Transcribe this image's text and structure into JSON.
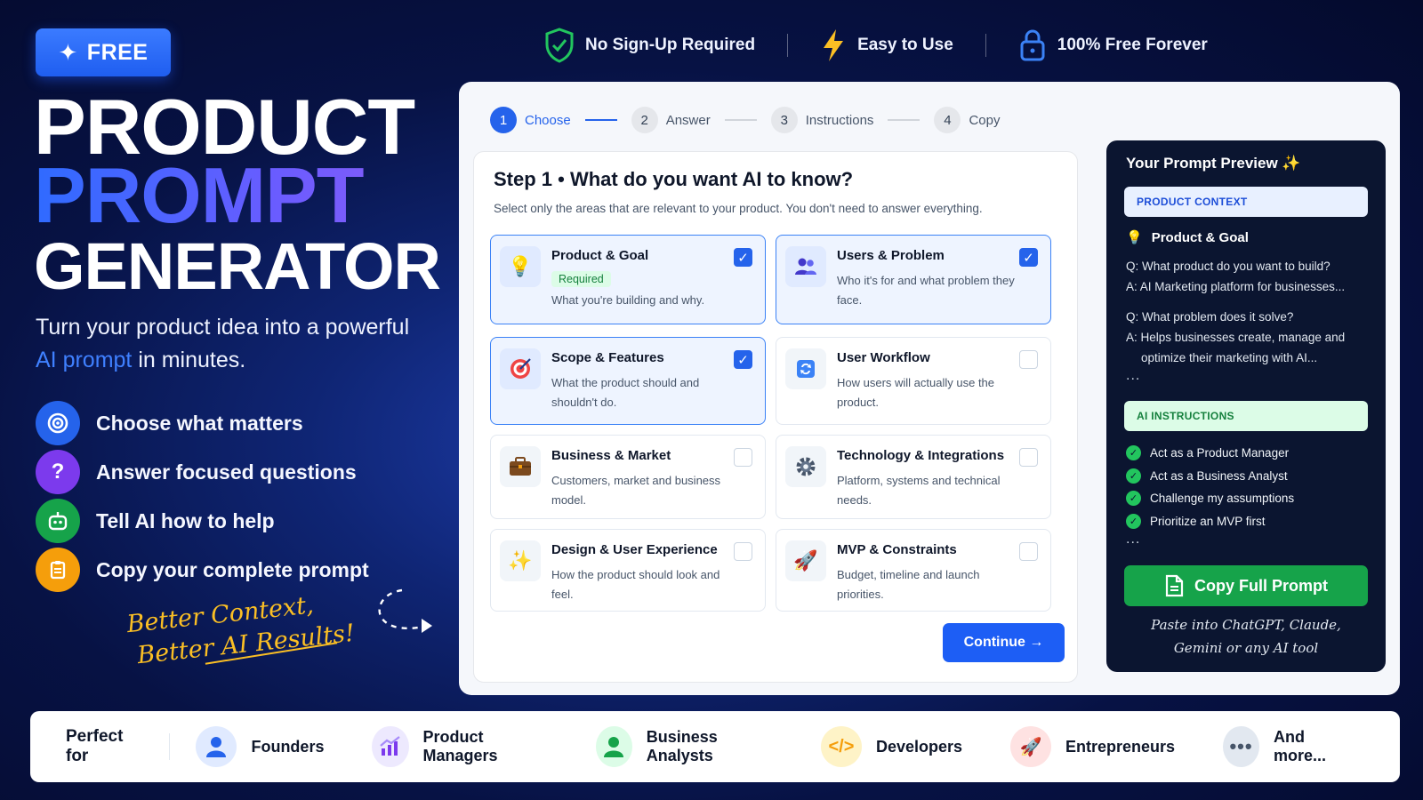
{
  "badge": {
    "label": "FREE"
  },
  "hero": {
    "line1": "PRODUCT",
    "line2": "PROMPT",
    "line3": "GENERATOR",
    "sub_a": "Turn your product idea into a powerful",
    "sub_highlight": "AI prompt",
    "sub_b": " in minutes."
  },
  "features": [
    {
      "icon": "target-icon",
      "label": "Choose what matters"
    },
    {
      "icon": "question-icon",
      "label": "Answer focused questions"
    },
    {
      "icon": "robot-icon",
      "label": "Tell AI how to help"
    },
    {
      "icon": "clipboard-icon",
      "label": "Copy your complete prompt"
    }
  ],
  "tagline": {
    "line1": "Better Context,",
    "line2": "Better AI Results!"
  },
  "top_pills": [
    {
      "icon": "shield-check-icon",
      "label": "No Sign-Up Required"
    },
    {
      "icon": "lightning-icon",
      "label": "Easy to Use"
    },
    {
      "icon": "lock-icon",
      "label": "100% Free Forever"
    }
  ],
  "stepper": [
    {
      "num": "1",
      "label": "Choose",
      "active": true
    },
    {
      "num": "2",
      "label": "Answer",
      "active": false
    },
    {
      "num": "3",
      "label": "Instructions",
      "active": false
    },
    {
      "num": "4",
      "label": "Copy",
      "active": false
    }
  ],
  "step1": {
    "title": "Step 1 • What do you want AI to know?",
    "desc": "Select only the areas that are relevant to your product. You don't need to answer everything.",
    "options": [
      {
        "icon": "lightbulb-icon",
        "title": "Product & Goal",
        "badge": "Required",
        "desc": "What you're building and why.",
        "checked": true
      },
      {
        "icon": "users-icon",
        "title": "Users & Problem",
        "desc": "Who it's for and what problem they face.",
        "checked": true
      },
      {
        "icon": "target-icon",
        "title": "Scope & Features",
        "desc": "What the product should and shouldn't do.",
        "checked": true
      },
      {
        "icon": "workflow-icon",
        "title": "User Workflow",
        "desc": "How users will actually use the product.",
        "checked": false
      },
      {
        "icon": "briefcase-icon",
        "title": "Business & Market",
        "desc": "Customers, market and business model.",
        "checked": false
      },
      {
        "icon": "gear-icon",
        "title": "Technology & Integrations",
        "desc": "Platform, systems and technical needs.",
        "checked": false
      },
      {
        "icon": "sparkle-icon",
        "title": "Design & User Experience",
        "desc": "How the product should look and feel.",
        "checked": false
      },
      {
        "icon": "rocket-icon",
        "title": "MVP & Constraints",
        "desc": "Budget, timeline and launch priorities.",
        "checked": false
      }
    ],
    "continue_label": "Continue →"
  },
  "preview": {
    "title": "Your Prompt Preview ✨",
    "context_label": "PRODUCT CONTEXT",
    "section": "Product & Goal",
    "q1": "Q: What product do you want to build?",
    "a1": "A: AI Marketing platform for businesses...",
    "q2": "Q: What problem does it solve?",
    "a2a": "A: Helps businesses create, manage and",
    "a2b": "optimize their marketing with AI...",
    "ellipsis": "...",
    "instructions_label": "AI INSTRUCTIONS",
    "instructions": [
      "Act as a Product Manager",
      "Act as a Business Analyst",
      "Challenge my assumptions",
      "Prioritize an MVP first"
    ],
    "copy_label": "Copy Full Prompt",
    "paste_line1": "Paste into ChatGPT, Claude,",
    "paste_line2": "Gemini or any AI tool"
  },
  "bottom": {
    "label": "Perfect for",
    "items": [
      {
        "icon": "person-icon",
        "label": "Founders",
        "color": "#2563eb",
        "bg": "#e0eaff"
      },
      {
        "icon": "chart-icon",
        "label": "Product Managers",
        "color": "#7c3aed",
        "bg": "#ede9fe"
      },
      {
        "icon": "person-icon",
        "label": "Business Analysts",
        "color": "#16a34a",
        "bg": "#dcfce7"
      },
      {
        "icon": "code-icon",
        "label": "Developers",
        "color": "#f59e0b",
        "bg": "#fef3c7"
      },
      {
        "icon": "rocket-icon",
        "label": "Entrepreneurs",
        "color": "#ef4444",
        "bg": "#fee2e2"
      },
      {
        "icon": "more-icon",
        "label": "And more...",
        "color": "#475569",
        "bg": "#e2e8f0"
      }
    ]
  }
}
